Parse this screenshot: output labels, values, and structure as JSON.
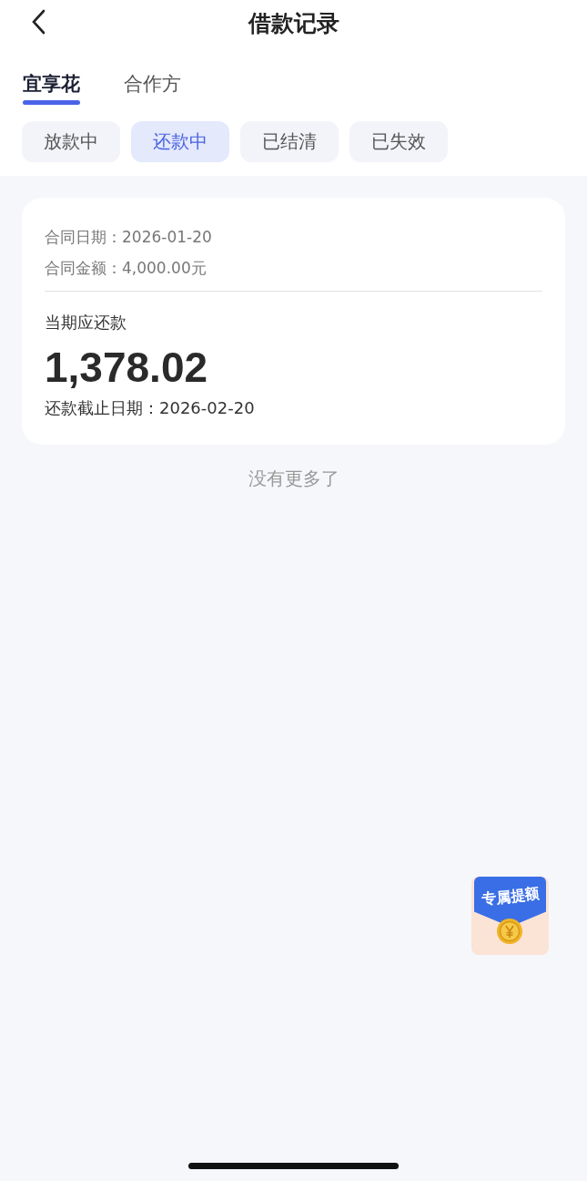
{
  "header": {
    "title": "借款记录"
  },
  "tabs": [
    {
      "label": "宜享花",
      "selected": true
    },
    {
      "label": "合作方",
      "selected": false
    }
  ],
  "filters": [
    {
      "label": "放款中",
      "selected": false
    },
    {
      "label": "还款中",
      "selected": true
    },
    {
      "label": "已结清",
      "selected": false
    },
    {
      "label": "已失效",
      "selected": false
    }
  ],
  "records": [
    {
      "contract_date": "合同日期：2026-01-20",
      "contract_amount": "合同金额：4,000.00元",
      "due_label": "当期应还款",
      "due_amount": "1,378.02",
      "due_date": "还款截止日期：2026-02-20"
    }
  ],
  "end_note": "没有更多了",
  "promo_badge": {
    "label": "专属提额"
  }
}
